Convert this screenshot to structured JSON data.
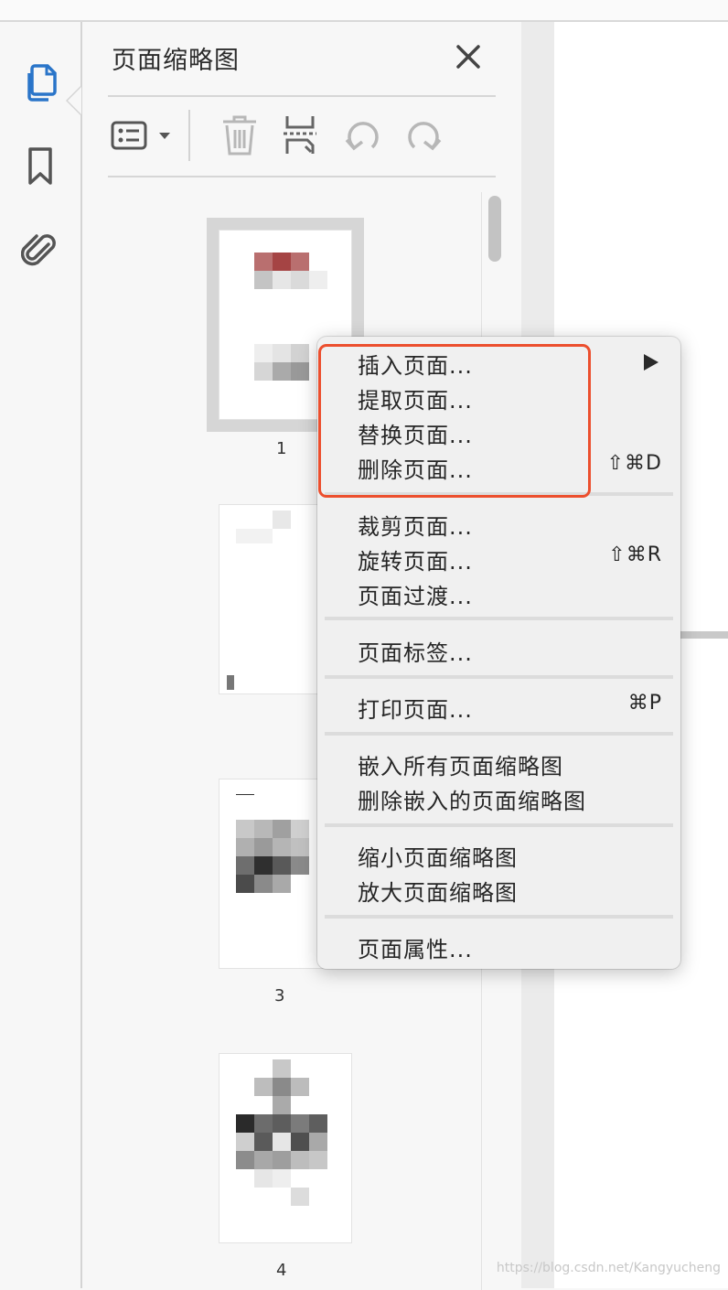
{
  "panel": {
    "title": "页面缩略图",
    "close_icon": "close-icon"
  },
  "left_rail": {
    "items": [
      {
        "icon": "pages-icon",
        "active": true
      },
      {
        "icon": "bookmark-icon",
        "active": false
      },
      {
        "icon": "attachment-icon",
        "active": false
      }
    ]
  },
  "toolbar": {
    "items": [
      "options-dropdown-icon",
      "trash-icon",
      "extract-icon",
      "rotate-counterclockwise-icon",
      "rotate-clockwise-icon"
    ]
  },
  "thumbnails": {
    "pages": [
      "1",
      "2",
      "3",
      "4"
    ],
    "visible_labels": [
      "1",
      "3",
      "4"
    ],
    "selected": "1"
  },
  "context_menu": {
    "groups": [
      [
        {
          "label": "插入页面...",
          "submenu": true
        },
        {
          "label": "提取页面..."
        },
        {
          "label": "替换页面..."
        },
        {
          "label": "删除页面...",
          "shortcut": "⇧⌘D"
        }
      ],
      [
        {
          "label": "裁剪页面..."
        },
        {
          "label": "旋转页面...",
          "shortcut": "⇧⌘R"
        },
        {
          "label": "页面过渡..."
        }
      ],
      [
        {
          "label": "页面标签..."
        }
      ],
      [
        {
          "label": "打印页面...",
          "shortcut": "⌘P"
        }
      ],
      [
        {
          "label": "嵌入所有页面缩略图"
        },
        {
          "label": "删除嵌入的页面缩略图"
        }
      ],
      [
        {
          "label": "缩小页面缩略图"
        },
        {
          "label": "放大页面缩略图"
        }
      ],
      [
        {
          "label": "页面属性..."
        }
      ]
    ]
  },
  "watermark": "https://blog.csdn.net/Kangyucheng",
  "colors": {
    "accent_blue": "#2a75c9",
    "highlight_red": "#ec4f2e"
  }
}
